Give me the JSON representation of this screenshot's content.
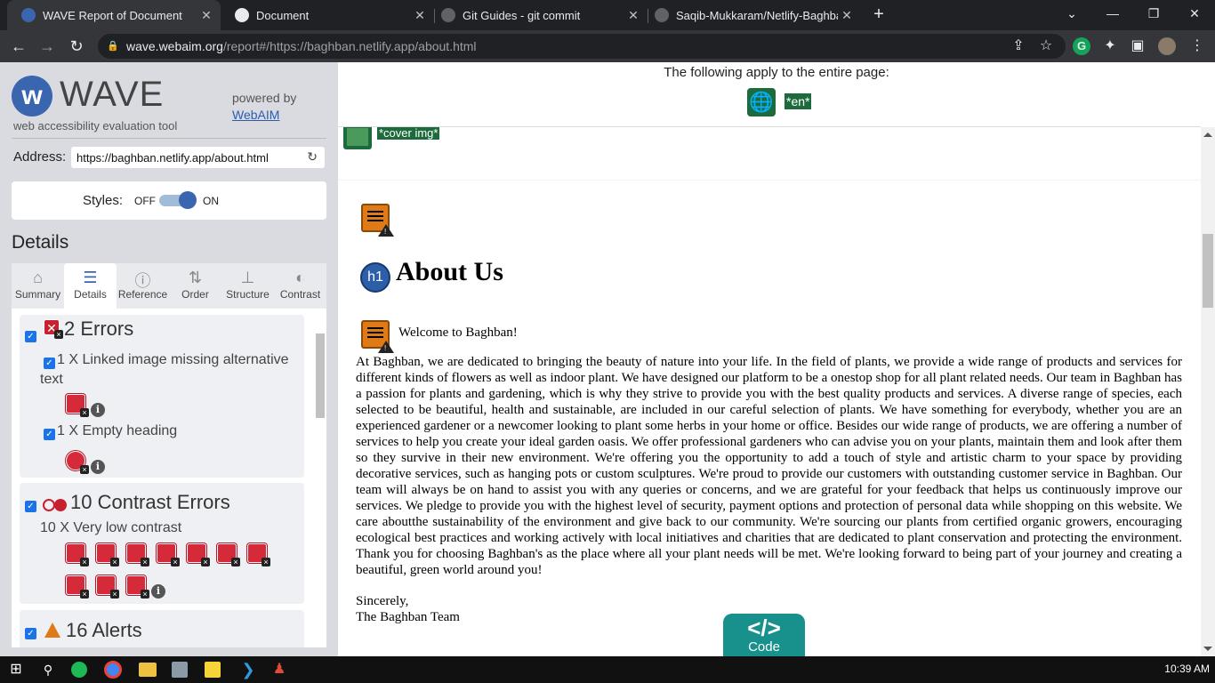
{
  "browser": {
    "tabs": [
      {
        "title": "WAVE Report of Document",
        "active": true
      },
      {
        "title": "Document",
        "active": false
      },
      {
        "title": "Git Guides - git commit",
        "active": false
      },
      {
        "title": "Saqib-Mukkaram/Netlify-Baghba",
        "active": false
      }
    ],
    "url_host": "wave.webaim.org",
    "url_path": "/report#/https://baghban.netlify.app/about.html"
  },
  "wave": {
    "logo_text": "WAVE",
    "tagline": "web accessibility evaluation tool",
    "powered_by": "powered by",
    "powered_link": "WebAIM",
    "address_label": "Address:",
    "address_value": "https://baghban.netlify.app/about.html",
    "styles_label": "Styles:",
    "styles_off": "OFF",
    "styles_on": "ON",
    "styles_state": "on",
    "details_heading": "Details",
    "tabs": [
      "Summary",
      "Details",
      "Reference",
      "Order",
      "Structure",
      "Contrast"
    ],
    "errors": {
      "heading": "2 Errors",
      "items": [
        "1 X Linked image missing alternative text",
        "1 X Empty heading"
      ]
    },
    "contrast": {
      "heading": "10 Contrast Errors",
      "item": "10 X Very low contrast",
      "count": 10
    },
    "alerts": {
      "heading": "16 Alerts"
    }
  },
  "page": {
    "apply_text": "The following apply to the entire page:",
    "lang_tag": "*en*",
    "cover_tag": "*cover img*",
    "h1_badge": "h1",
    "heading": "About Us",
    "welcome": "Welcome to Baghban!",
    "paragraph": "At Baghban, we are dedicated to bringing the beauty of nature into your life. In the field of plants, we provide a wide range of products and services for different kinds of flowers as well as indoor plant. We have designed our platform to be a onestop shop for all plant related needs. Our team in Baghban has a passion for plants and gardening, which is why they strive to provide you with the best quality products and services. A diverse range of species, each selected to be beautiful, health and sustainable, are included in our careful selection of plants. We have something for everybody, whether you are an experienced gardener or a newcomer looking to plant some herbs in your home or office. Besides our wide range of products, we are offering a number of services to help you create your ideal garden oasis. We offer professional gardeners who can advise you on your plants, maintain them and look after them so they survive in their new environment. We're offering you the opportunity to add a touch of style and artistic charm to your space by providing decorative services, such as hanging pots or custom sculptures. We're proud to provide our customers with outstanding customer service in Baghban. Our team will always be on hand to assist you with any queries or concerns, and we are grateful for your feedback that helps us continuously improve our services. We pledge to provide you with the highest level of security, payment options and protection of personal data while shopping on this website. We care aboutthe sustainability of the environment and give back to our community. We're sourcing our plants from certified organic growers, encouraging ecological best practices and working actively with local initiatives and charities that are dedicated to plant conservation and protecting the environment. Thank you for choosing Baghban's as the place where all your plant needs will be met. We're looking forward to being part of your journey and creating a beautiful, green world around you!",
    "sincerely": "Sincerely,",
    "signoff": "The Baghban Team",
    "code_button": "Code",
    "code_glyph": "</>"
  },
  "taskbar": {
    "time": "10:39 AM"
  },
  "colors": {
    "wave_blue": "#3a66b0",
    "error_red": "#d42a3a",
    "alert_orange": "#e07a16",
    "feature_green": "#1d6b3c",
    "code_teal": "#18908c"
  }
}
